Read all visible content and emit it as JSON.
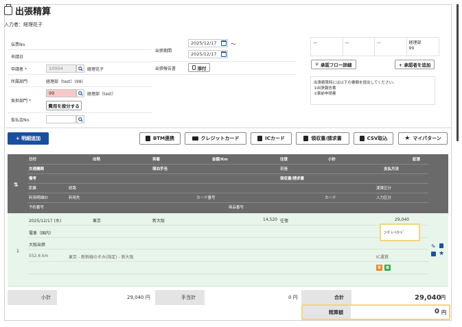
{
  "page": {
    "title": "出張精算",
    "inputter": "入力者：経理花子"
  },
  "form": {
    "slip_no_label": "伝票No.",
    "apply_date_label": "申請日",
    "applicant_label": "申請者",
    "applicant_code": "10004",
    "applicant_name": "経理花子",
    "dept_label": "所属部門",
    "dept_value": "経理部（test）(99)",
    "burden_dept_label": "負担部門",
    "burden_dept_code": "99",
    "burden_dept_name": "経理部（test）",
    "split_cost_button": "費用を按分する",
    "advance_label": "仮払金No.",
    "trip_period_label": "出張期間",
    "period_from": "2025/12/17",
    "period_to": "2025/12/17",
    "period_sep": "〜",
    "report_label": "出張報告書",
    "attach_button": "添付",
    "required_mark": "*"
  },
  "approval": {
    "cells": [
      "—",
      "—",
      "—",
      "経理部\n99"
    ],
    "flow_button": "承認フロー詳細",
    "add_approver_button": "+ 承認者を追加",
    "note": "出張精算時には以下の書類を提出してください。\n①出張報告書\n②事前申請書"
  },
  "toolbar": {
    "add_detail": "+ 明細追加",
    "btm": "BTM連携",
    "credit": "クレジットカード",
    "ic": "ICカード",
    "receipt": "領収書/請求書",
    "csv": "CSV取込",
    "mypattern": "マイパターン"
  },
  "table": {
    "head": {
      "row1": [
        "日付",
        "出発",
        "到着",
        "金額/Km",
        "往復",
        "小計",
        "証憑"
      ],
      "row2": [
        "交通機関",
        "宿泊手当",
        "日当",
        "支払方法"
      ],
      "row3": [
        "備考",
        "領収書/請求書"
      ],
      "row4": [
        "距離",
        "経路",
        "運賃区分"
      ],
      "row5": [
        "利用明細ID",
        "利用先",
        "カード番号",
        "カード",
        "入力区分"
      ],
      "row6": [
        "予約番号",
        "商品番号"
      ]
    },
    "row": {
      "no": "1",
      "date": "2025/12/17 (水)",
      "from": "東京",
      "to": "新大阪",
      "amount": "14,520",
      "roundtrip": "往復",
      "subtotal": "29,040",
      "transport": "電車（国内）",
      "payment": "ｺｰﾎﾟﾚｰﾄｶｰﾄﾞ",
      "remark": "大阪出張",
      "distance": "552.6 km",
      "route": "東京 - 新幹線のぞみ(指定) - 新大阪",
      "fare_type": "IC運賃",
      "badge1": "早",
      "badge2": "楽"
    }
  },
  "totals": {
    "subtotal_label": "小計",
    "subtotal_value": "29,040 円",
    "allowance_label": "手当計",
    "allowance_value": "0 円",
    "total_label": "合計",
    "total_value": "29,040",
    "total_unit": "円",
    "settle_label": "精算額",
    "settle_value": "0",
    "settle_unit": "円"
  },
  "colors": {
    "primary": "#1a4fa0",
    "header_bg": "#6a6a6a",
    "row_bg": "#e8f5ea",
    "highlight": "#f2d67a",
    "badge_orange": "#e8892b",
    "badge_green": "#3aa84a"
  }
}
